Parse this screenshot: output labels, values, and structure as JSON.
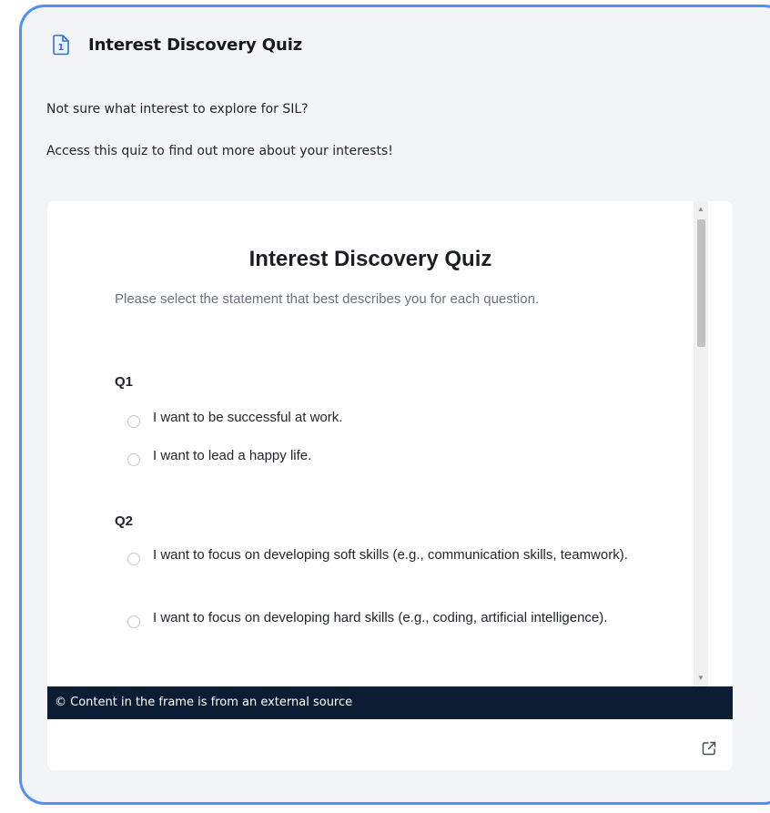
{
  "card": {
    "title": "Interest Discovery Quiz",
    "icon": "document-number-1-icon",
    "intro_line_1": "Not sure what interest to explore for SIL?",
    "intro_line_2": "Access this quiz to find out more about your interests!",
    "accent_color": "#4f8ff7"
  },
  "quiz": {
    "title": "Interest Discovery Quiz",
    "subtitle": "Please select the statement that best describes you for each question.",
    "questions": [
      {
        "label": "Q1",
        "options": [
          "I want to be successful at work.",
          "I want to lead a happy life."
        ]
      },
      {
        "label": "Q2",
        "options": [
          "I want to focus on developing soft skills (e.g., communication skills, teamwork).",
          "I want to focus on developing hard skills (e.g., coding, artificial intelligence)."
        ]
      }
    ]
  },
  "embed": {
    "source_notice": "© Content in the frame is from an external source",
    "source_bar_color": "#0c1d33",
    "open_external_icon": "external-link-icon"
  }
}
